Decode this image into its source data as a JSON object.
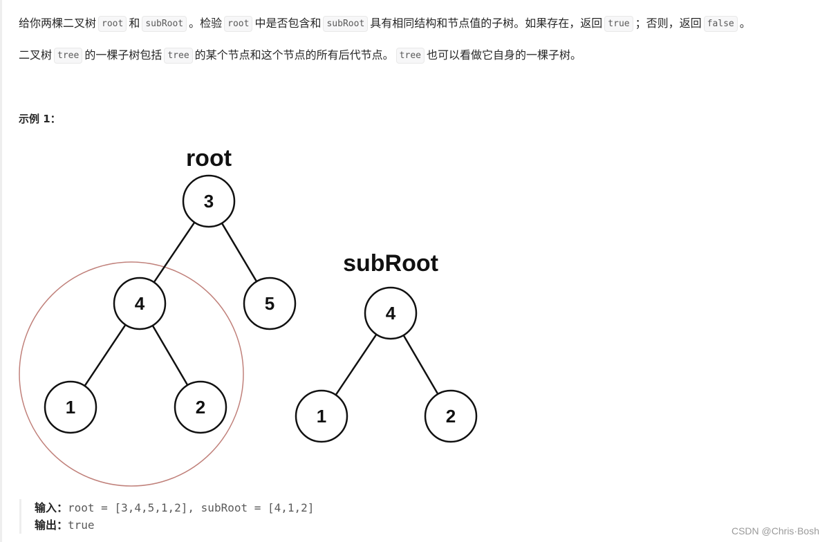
{
  "problem": {
    "paragraph1": [
      {
        "text": "给你两棵二叉树",
        "code": false
      },
      {
        "text": "root",
        "code": true
      },
      {
        "text": "和",
        "code": false
      },
      {
        "text": "subRoot",
        "code": true
      },
      {
        "text": "。检验",
        "code": false
      },
      {
        "text": "root",
        "code": true
      },
      {
        "text": "中是否包含和",
        "code": false
      },
      {
        "text": "subRoot",
        "code": true
      },
      {
        "text": "具有相同结构和节点值的子树。如果存在，返回",
        "code": false
      },
      {
        "text": "true",
        "code": true
      },
      {
        "text": "；否则，返回",
        "code": false
      },
      {
        "text": "false",
        "code": true
      },
      {
        "text": "。",
        "code": false
      }
    ],
    "paragraph2": [
      {
        "text": "二叉树",
        "code": false
      },
      {
        "text": "tree",
        "code": true
      },
      {
        "text": "的一棵子树包括",
        "code": false
      },
      {
        "text": "tree",
        "code": true
      },
      {
        "text": "的某个节点和这个节点的所有后代节点。",
        "code": false
      },
      {
        "text": "tree",
        "code": true
      },
      {
        "text": "也可以看做它自身的一棵子树。",
        "code": false
      }
    ]
  },
  "example": {
    "title": "示例 1：",
    "diagram": {
      "root_label": "root",
      "subroot_label": "subRoot",
      "root_tree": {
        "nodes": [
          {
            "id": "r3",
            "value": "3"
          },
          {
            "id": "r4",
            "value": "4"
          },
          {
            "id": "r5",
            "value": "5"
          },
          {
            "id": "r1",
            "value": "1"
          },
          {
            "id": "r2",
            "value": "2"
          }
        ],
        "edges": [
          [
            "r3",
            "r4"
          ],
          [
            "r3",
            "r5"
          ],
          [
            "r4",
            "r1"
          ],
          [
            "r4",
            "r2"
          ]
        ]
      },
      "subroot_tree": {
        "nodes": [
          {
            "id": "s4",
            "value": "4"
          },
          {
            "id": "s1",
            "value": "1"
          },
          {
            "id": "s2",
            "value": "2"
          }
        ],
        "edges": [
          [
            "s4",
            "s1"
          ],
          [
            "s4",
            "s2"
          ]
        ]
      },
      "highlight": {
        "around": "r4",
        "color": "#c0807a"
      }
    },
    "input_label": "输入：",
    "input_value": "root = [3,4,5,1,2], subRoot = [4,1,2]",
    "output_label": "输出：",
    "output_value": "true"
  },
  "watermark": "CSDN @Chris·Bosh"
}
